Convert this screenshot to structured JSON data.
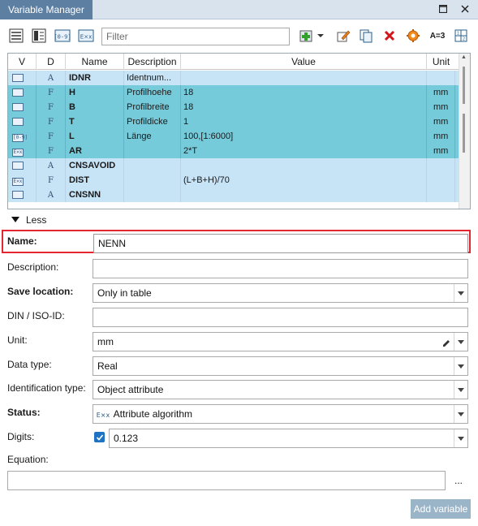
{
  "window": {
    "title": "Variable Manager"
  },
  "toolbar": {
    "filter_placeholder": "Filter",
    "a3_label": "A=3"
  },
  "table": {
    "columns": [
      "V",
      "D",
      "Name",
      "Description",
      "Value",
      "Unit"
    ],
    "rows": [
      {
        "v": "calc",
        "d": "A",
        "name": "IDNR",
        "description": "Identnum...",
        "value": "",
        "unit": "",
        "state": "plain"
      },
      {
        "v": "calc",
        "d": "F",
        "name": "H",
        "description": "Profilhoehe",
        "value": "18",
        "unit": "mm",
        "state": "selected"
      },
      {
        "v": "calc",
        "d": "F",
        "name": "B",
        "description": "Profilbreite",
        "value": "18",
        "unit": "mm",
        "state": "selected"
      },
      {
        "v": "calc",
        "d": "F",
        "name": "T",
        "description": "Profildicke",
        "value": "1",
        "unit": "mm",
        "state": "selected"
      },
      {
        "v": "[0-9]",
        "d": "F",
        "name": "L",
        "description": "Länge",
        "value": "100,[1:6000]",
        "unit": "mm",
        "state": "selected"
      },
      {
        "v": "E×x",
        "d": "F",
        "name": "AR",
        "description": "",
        "value": "2*T",
        "unit": "mm",
        "state": "selected"
      },
      {
        "v": "calc",
        "d": "A",
        "name": "CNSAVOID",
        "description": "",
        "value": "",
        "unit": "",
        "state": "plain"
      },
      {
        "v": "E×x",
        "d": "F",
        "name": "DIST",
        "description": "",
        "value": "(L+B+H)/70",
        "unit": "",
        "state": "plain"
      },
      {
        "v": "calc",
        "d": "A",
        "name": "CNSNN",
        "description": "",
        "value": "",
        "unit": "",
        "state": "plain"
      }
    ]
  },
  "less_label": "Less",
  "form": {
    "name_label": "Name:",
    "name_value": "NENN",
    "description_label": "Description:",
    "description_value": "",
    "save_location_label": "Save location:",
    "save_location_value": "Only in table",
    "din_label": "DIN / ISO-ID:",
    "din_value": "",
    "unit_label": "Unit:",
    "unit_value": "mm",
    "data_type_label": "Data type:",
    "data_type_value": "Real",
    "identification_type_label": "Identification type:",
    "identification_type_value": "Object attribute",
    "status_label": "Status:",
    "status_value": "Attribute algorithm",
    "digits_label": "Digits:",
    "digits_checked": true,
    "digits_value": "0.123",
    "equation_label": "Equation:",
    "equation_value": "",
    "equation_more": "...",
    "add_button": "Add variable"
  }
}
